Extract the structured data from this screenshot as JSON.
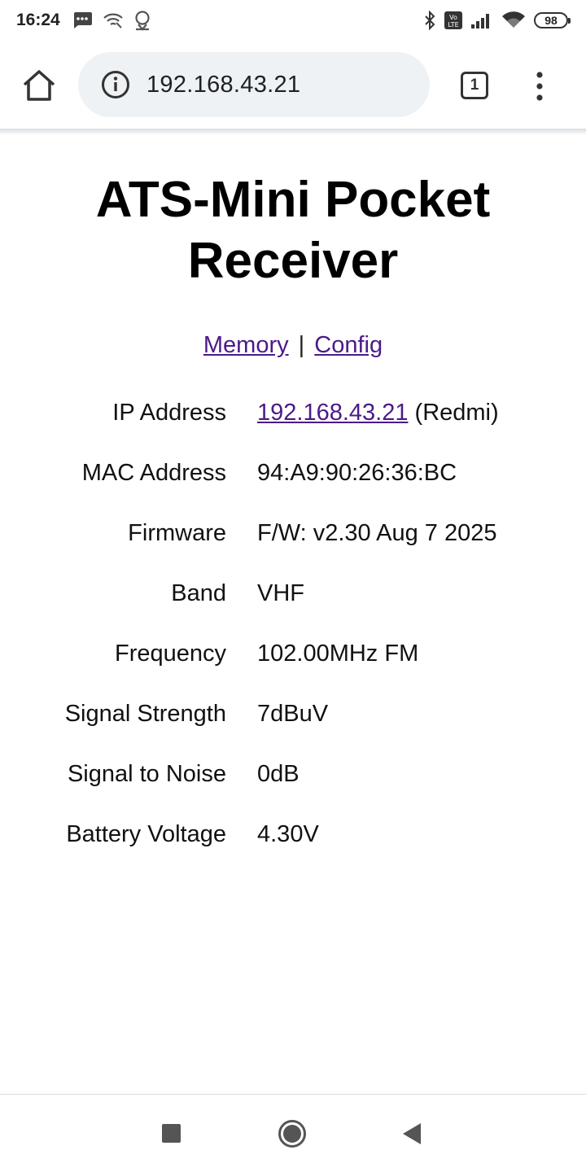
{
  "status_bar": {
    "time": "16:24",
    "battery": "98",
    "icons_left": [
      "message-icon",
      "wifi-calling-icon",
      "location-icon"
    ],
    "icons_right": [
      "bluetooth-icon",
      "volte-icon",
      "cell-signal-icon",
      "wifi-icon",
      "battery-icon"
    ]
  },
  "browser": {
    "url": "192.168.43.21",
    "tab_count": "1",
    "icons": [
      "home-icon",
      "info-icon",
      "tab-switcher-icon",
      "more-vert-icon"
    ]
  },
  "page": {
    "title": "ATS-Mini Pocket Receiver",
    "nav": {
      "memory": "Memory",
      "separator": "|",
      "config": "Config"
    },
    "rows": [
      {
        "label": "IP Address",
        "value": "192.168.43.21",
        "suffix": "(Redmi)"
      },
      {
        "label": "MAC Address",
        "value": "94:A9:90:26:36:BC"
      },
      {
        "label": "Firmware",
        "value": "F/W: v2.30 Aug 7 2025"
      },
      {
        "label": "Band",
        "value": "VHF"
      },
      {
        "label": "Frequency",
        "value": "102.00MHz FM"
      },
      {
        "label": "Signal Strength",
        "value": "7dBuV"
      },
      {
        "label": "Signal to Noise",
        "value": "0dB"
      },
      {
        "label": "Battery Voltage",
        "value": "4.30V"
      }
    ]
  },
  "colors": {
    "link": "#4b1a8a",
    "omnibox": "#eef2f4"
  }
}
